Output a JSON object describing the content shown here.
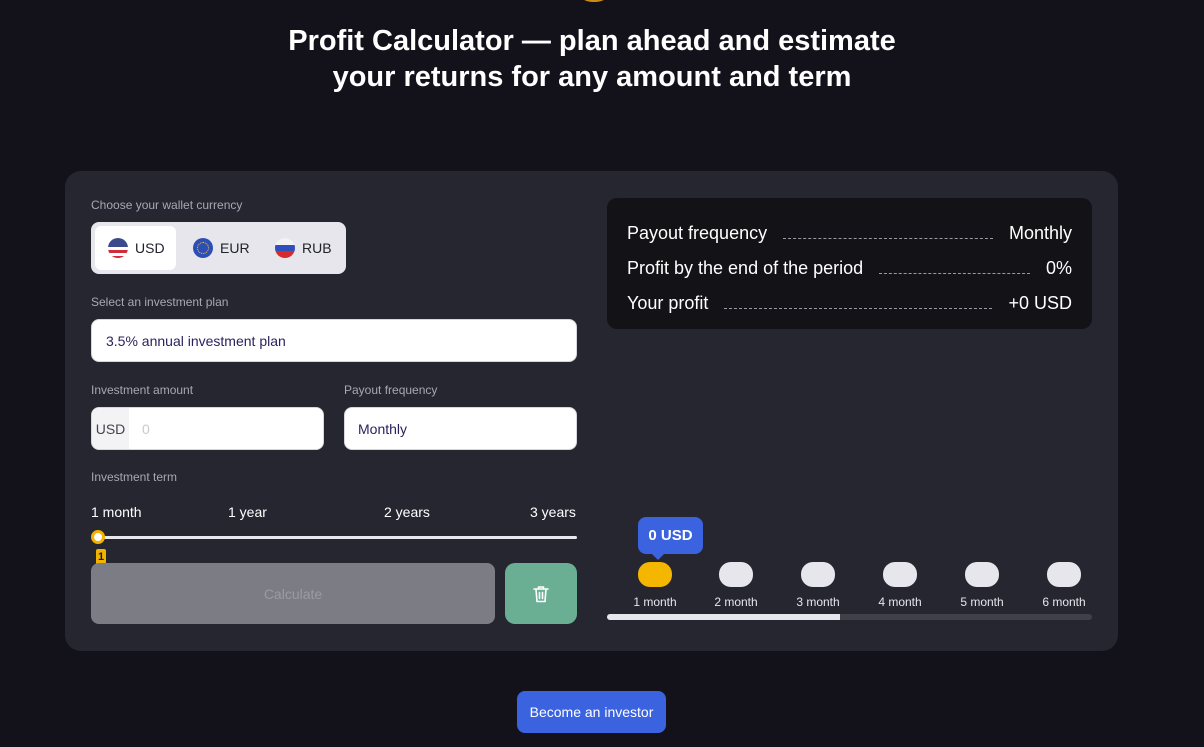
{
  "page": {
    "title": "Profit Calculator — plan ahead and estimate your returns for any amount and term"
  },
  "currency": {
    "label": "Choose your wallet currency",
    "options": [
      {
        "code": "USD",
        "icon": "us-flag-icon",
        "selected": true
      },
      {
        "code": "EUR",
        "icon": "eu-flag-icon",
        "selected": false
      },
      {
        "code": "RUB",
        "icon": "ru-flag-icon",
        "selected": false
      }
    ]
  },
  "plan": {
    "label": "Select an investment plan",
    "value": "3.5% annual investment plan"
  },
  "amount": {
    "label": "Investment amount",
    "prefix": "USD",
    "placeholder": "0"
  },
  "frequency": {
    "label": "Payout frequency",
    "value": "Monthly"
  },
  "term": {
    "label": "Investment term",
    "ticks": [
      "1 month",
      "1 year",
      "2 years",
      "3 years"
    ],
    "slider_value": "1"
  },
  "buttons": {
    "calculate": "Calculate",
    "trash_icon": "trash-icon",
    "become_investor": "Become an investor"
  },
  "summary": {
    "rows": [
      {
        "label": "Payout frequency",
        "value": "Monthly"
      },
      {
        "label": "Profit by the end of the period",
        "value": "0%"
      },
      {
        "label": "Your profit",
        "value": "+0 USD"
      }
    ]
  },
  "timeline": {
    "tooltip": "0 USD",
    "months": [
      "1 month",
      "2 month",
      "3 month",
      "4 month",
      "5 month",
      "6 month"
    ],
    "active_index": 0,
    "scroll_fraction": 0.48
  },
  "colors": {
    "background": "#13121b",
    "card": "#252630",
    "accent_blue": "#3b63e0",
    "accent_yellow": "#f5b600",
    "trash_green": "#6aae94"
  }
}
